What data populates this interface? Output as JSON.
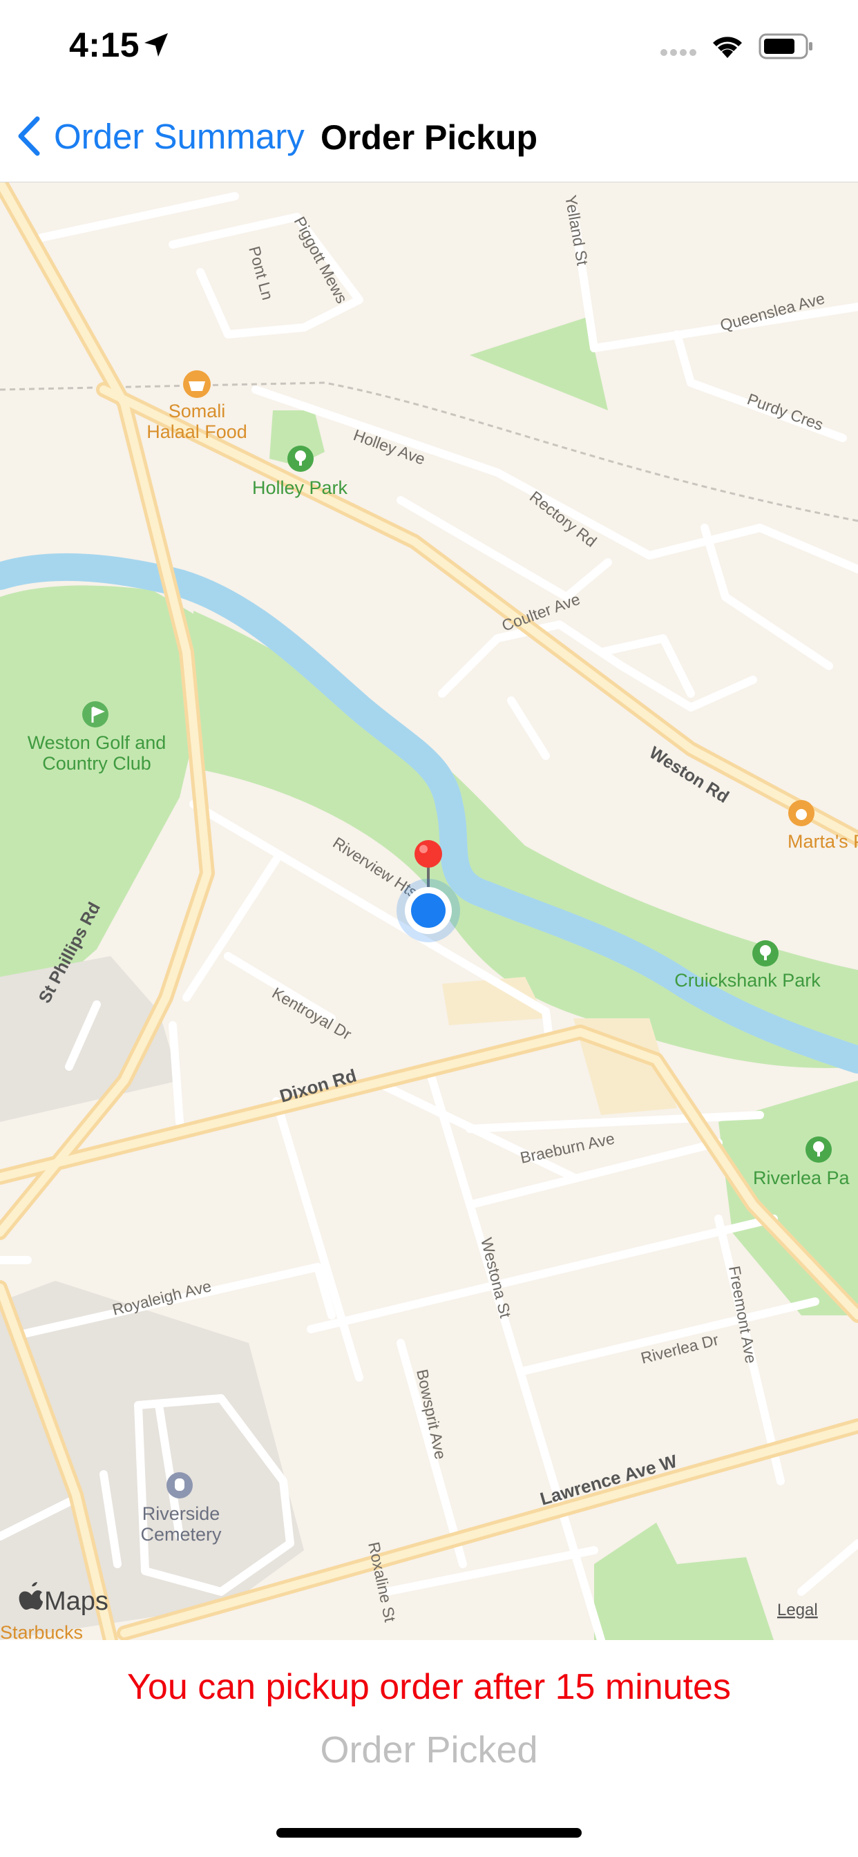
{
  "status_bar": {
    "time": "4:15"
  },
  "nav": {
    "back_label": "Order Summary",
    "title": "Order Pickup"
  },
  "map": {
    "pois": {
      "somali": "Somali\nHalaal Food",
      "holley_park": "Holley Park",
      "weston_golf": "Weston Golf and\nCountry Club",
      "martas": "Marta's Pet Sh",
      "cruickshank": "Cruickshank Park",
      "riverlea_park": "Riverlea Pa",
      "riverside_cemetery": "Riverside\nCemetery",
      "starbucks": "Starbucks"
    },
    "streets": {
      "pont_ln": "Pont Ln",
      "piggott": "Piggott Mews",
      "yelland": "Yelland St",
      "queenslea": "Queenslea Ave",
      "purdy": "Purdy Cres",
      "holley_ave": "Holley Ave",
      "rectory": "Rectory Rd",
      "coulter": "Coulter Ave",
      "weston_rd": "Weston Rd",
      "st_phillips": "St Phillips Rd",
      "riverview": "Riverview Hts",
      "kentroyal": "Kentroyal Dr",
      "dixon": "Dixon Rd",
      "braeburn": "Braeburn Ave",
      "westona": "Westona St",
      "freemont": "Freemont Ave",
      "royaleigh": "Royaleigh Ave",
      "riverlea_dr": "Riverlea Dr",
      "bowsprit": "Bowsprit Ave",
      "lawrence": "Lawrence Ave W",
      "roxaline": "Roxaline St"
    },
    "attribution": "Maps",
    "legal": "Legal"
  },
  "pickup_message": "You can pickup order after 15 minutes",
  "order_picked_label": "Order Picked"
}
